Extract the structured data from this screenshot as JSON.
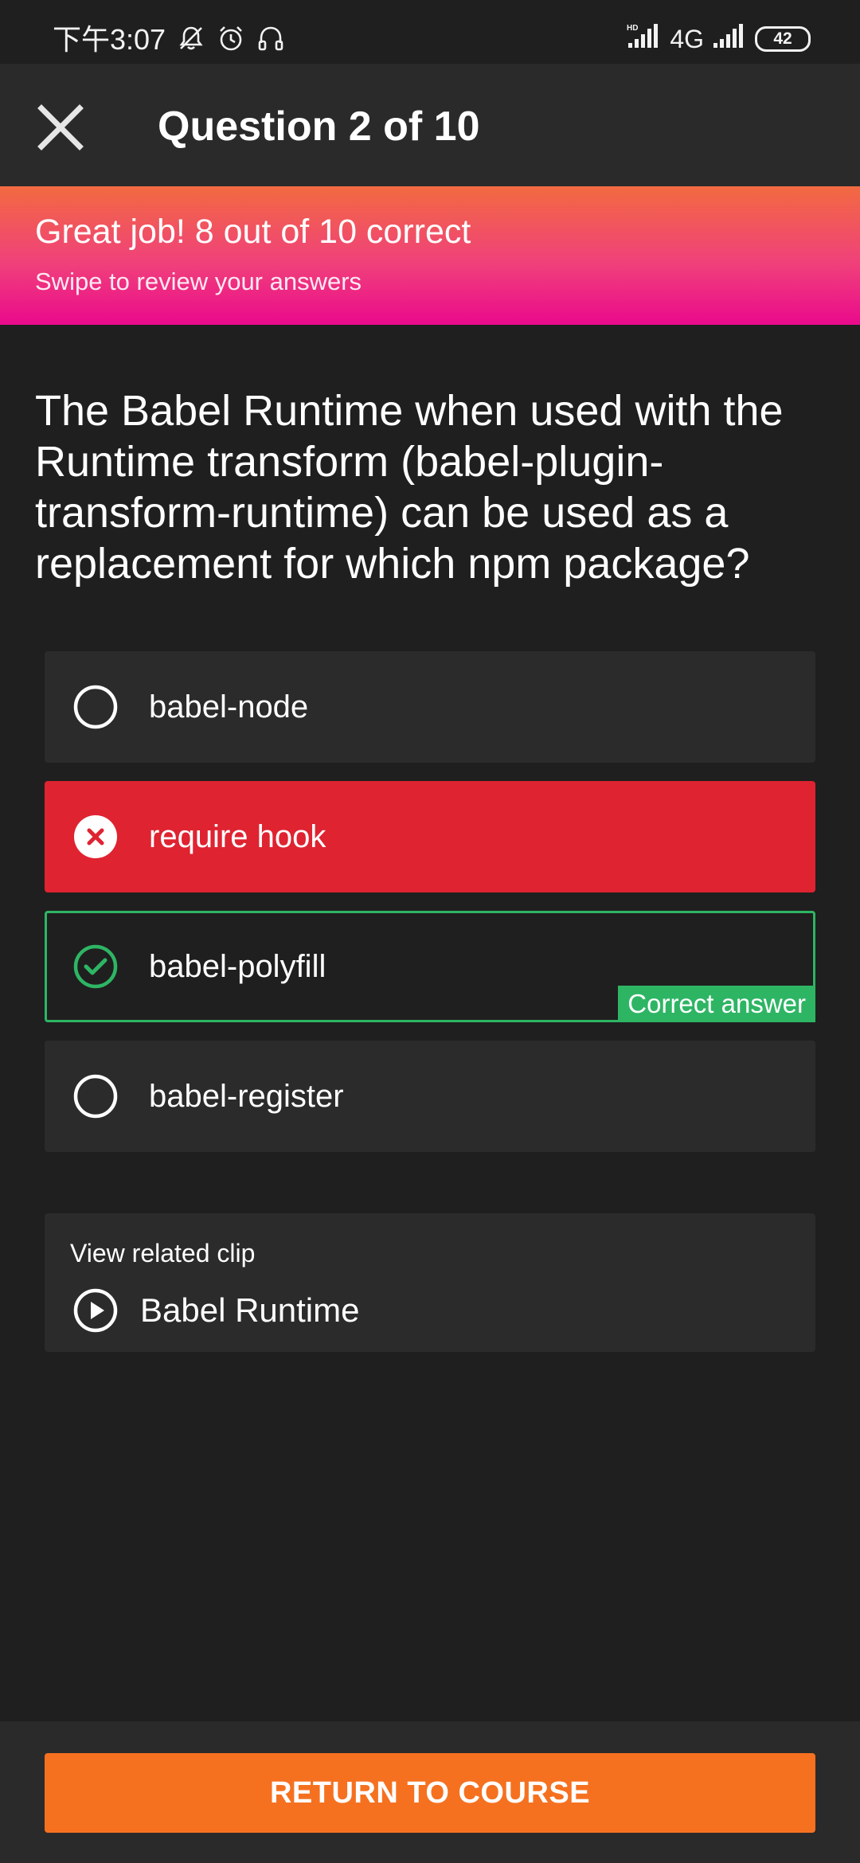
{
  "status_bar": {
    "time": "下午3:07",
    "network": "4G",
    "battery": "42",
    "left_icons": [
      "mute-bell-icon",
      "alarm-icon",
      "headset-icon"
    ],
    "right_icons": [
      "hd-signal-icon",
      "signal-icon",
      "battery-icon"
    ]
  },
  "header": {
    "title": "Question 2 of 10",
    "close_icon": "close-icon"
  },
  "banner": {
    "title": "Great job! 8 out of 10 correct",
    "subtitle": "Swipe to review your answers"
  },
  "question": {
    "text": "The Babel Runtime when used with the Runtime transform (babel-plugin-transform-runtime) can be used as a replacement for which npm package?"
  },
  "options": [
    {
      "label": "babel-node",
      "state": "unselected",
      "icon": "radio-empty-icon"
    },
    {
      "label": "require hook",
      "state": "wrong",
      "icon": "cross-circle-icon"
    },
    {
      "label": "babel-polyfill",
      "state": "correct",
      "icon": "check-circle-icon",
      "tag": "Correct answer"
    },
    {
      "label": "babel-register",
      "state": "unselected",
      "icon": "radio-empty-icon"
    }
  ],
  "related_clip": {
    "caption": "View related clip",
    "title": "Babel Runtime",
    "icon": "play-circle-icon"
  },
  "footer": {
    "button_label": "RETURN TO COURSE"
  },
  "colors": {
    "background": "#1f1f1f",
    "header": "#2a2a2a",
    "card": "#2b2b2b",
    "wrong": "#df2331",
    "correct": "#2eb564",
    "accent_orange": "#f57120",
    "banner_top": "#f26a40",
    "banner_bottom": "#ea0a8c"
  }
}
